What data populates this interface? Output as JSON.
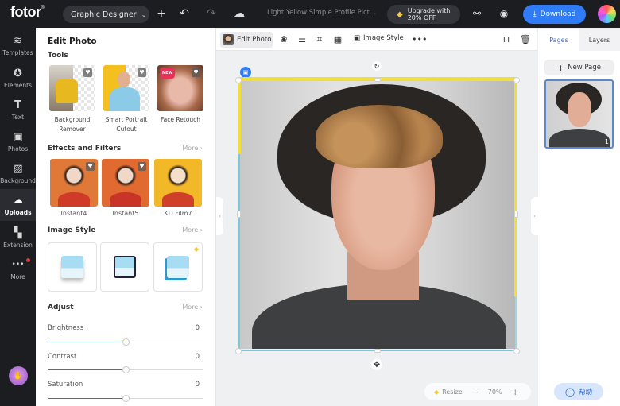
{
  "topbar": {
    "logo": "fotor",
    "workspace_select": "Graphic Designer",
    "document_title": "Light Yellow Simple Profile Pict...",
    "upgrade_line1": "Upgrade with",
    "upgrade_line2": "20% OFF",
    "download_label": "Download",
    "icons": [
      "plus-icon",
      "undo-icon",
      "redo-icon",
      "cloud-saved-icon",
      "share-icon",
      "preview-eye-icon"
    ]
  },
  "leftnav": {
    "items": [
      {
        "label": "Templates",
        "icon": "layers-icon",
        "glyph": "≋"
      },
      {
        "label": "Elements",
        "icon": "star-circle-icon",
        "glyph": "✪"
      },
      {
        "label": "Text",
        "icon": "text-t-icon",
        "glyph": "T"
      },
      {
        "label": "Photos",
        "icon": "photo-icon",
        "glyph": "▣"
      },
      {
        "label": "Background",
        "icon": "background-stripes-icon",
        "glyph": "▨"
      },
      {
        "label": "Uploads",
        "icon": "cloud-upload-icon",
        "glyph": "☁",
        "active": true
      },
      {
        "label": "Extension",
        "icon": "extension-icon",
        "glyph": "▚"
      },
      {
        "label": "More",
        "icon": "more-dots-icon",
        "glyph": "•••",
        "notification": true
      }
    ]
  },
  "panel": {
    "title": "Edit Photo",
    "tools_title": "Tools",
    "tools": [
      {
        "line1": "Background",
        "line2": "Remover"
      },
      {
        "line1": "Smart Portrait",
        "line2": "Cutout"
      },
      {
        "line1": "Face Retouch",
        "line2": "",
        "badge": "NEW"
      }
    ],
    "effects_title": "Effects and Filters",
    "more_label": "More",
    "filters": [
      "Instant4",
      "Instant5",
      "KD Film7"
    ],
    "image_style_title": "Image Style",
    "adjust_title": "Adjust",
    "adjust": [
      {
        "label": "Brightness",
        "value": "0",
        "position_pct": 50
      },
      {
        "label": "Contrast",
        "value": "0",
        "position_pct": 50
      },
      {
        "label": "Saturation",
        "value": "0",
        "position_pct": 50
      }
    ]
  },
  "context_bar": {
    "edit_photo_label": "Edit Photo",
    "image_style_label": "Image Style"
  },
  "canvas": {
    "zoom_value": "70%",
    "resize_label": "Resize"
  },
  "rightpanel": {
    "tabs": [
      "Pages",
      "Layers"
    ],
    "active_tab": "Pages",
    "new_page_label": "New Page",
    "page_number": "1"
  },
  "help": {
    "label": "帮助"
  },
  "colors": {
    "accent_blue": "#2f7cf6",
    "selection_yellow": "#f2de3a",
    "dark_bg": "#1c1d21",
    "premium_gold": "#f5c542"
  }
}
